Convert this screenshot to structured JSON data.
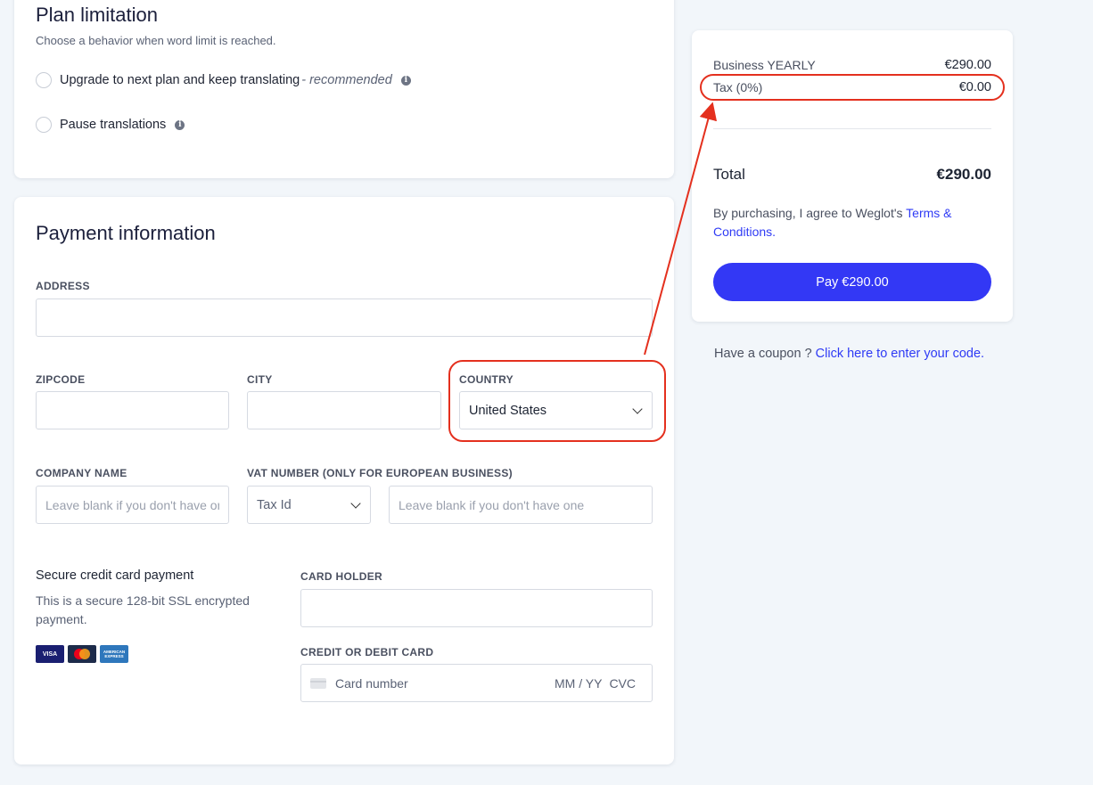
{
  "plan": {
    "title": "Plan limitation",
    "subtitle": "Choose a behavior when word limit is reached.",
    "options": [
      {
        "label": "Upgrade to next plan and keep translating",
        "suffix": "- recommended"
      },
      {
        "label": "Pause translations",
        "suffix": ""
      }
    ]
  },
  "payment": {
    "title": "Payment information",
    "address_label": "ADDRESS",
    "zipcode_label": "ZIPCODE",
    "city_label": "CITY",
    "country_label": "COUNTRY",
    "country_value": "United States",
    "company_label": "COMPANY NAME",
    "company_placeholder": "Leave blank if you don't have one",
    "vat_label": "VAT NUMBER (ONLY FOR EUROPEAN BUSINESS)",
    "tax_id_value": "Tax Id",
    "vat_placeholder": "Leave blank if you don't have one",
    "secure_title": "Secure credit card payment",
    "secure_text": "This is a secure 128-bit SSL encrypted payment.",
    "card_logos": [
      "VISA",
      "MasterCard",
      "AMERICAN EXPRESS"
    ],
    "card_holder_label": "CARD HOLDER",
    "card_label": "CREDIT OR DEBIT CARD",
    "card_number_placeholder": "Card number",
    "card_expiry_placeholder": "MM / YY",
    "card_cvc_placeholder": "CVC"
  },
  "summary": {
    "plan_label": "Business YEARLY",
    "plan_price": "€290.00",
    "tax_label": "Tax (0%)",
    "tax_value": "€0.00",
    "total_label": "Total",
    "total_value": "€290.00",
    "agree_text": "By purchasing, I agree to Weglot's ",
    "terms_link": "Terms & Conditions",
    "agree_end": ".",
    "pay_button": "Pay €290.00"
  },
  "coupon": {
    "text": "Have a coupon ? ",
    "link": "Click here to enter your code."
  },
  "colors": {
    "accent": "#3338f5",
    "link": "#2f3bf5",
    "annotation": "#e4301e",
    "background": "#f2f6fa"
  }
}
